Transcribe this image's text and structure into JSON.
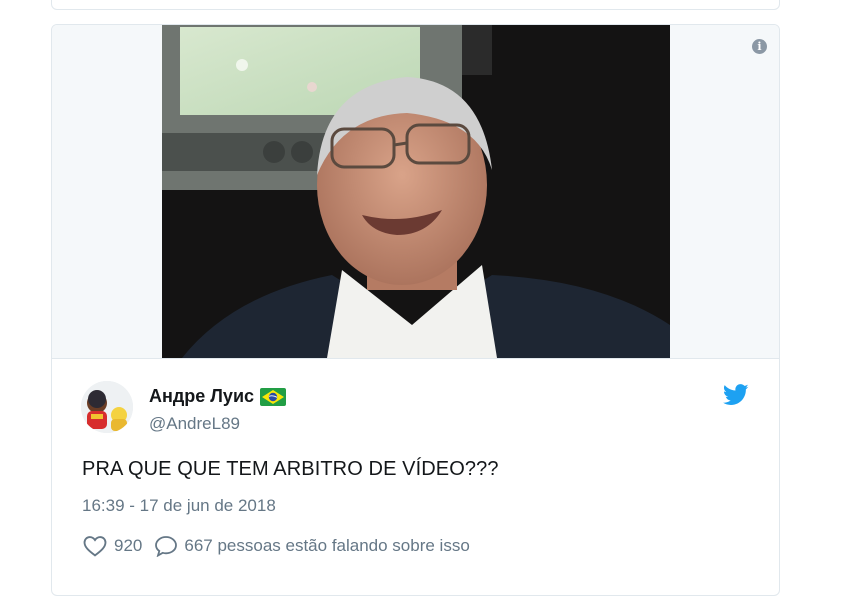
{
  "tweet": {
    "display_name": "Андре Луис",
    "handle": "@AndreL89",
    "text": "PRA QUE QUE TEM ARBITRO DE VÍDEO???",
    "timestamp": "16:39 - 17 de jun de 2018",
    "likes": "920",
    "conversation": "667 pessoas estão falando sobre isso"
  },
  "icons": {
    "info": "info-icon",
    "bird": "twitter-bird-icon",
    "flag": "brazil-flag-icon",
    "like": "heart-icon",
    "reply": "speech-bubble-icon"
  },
  "colors": {
    "accent": "#1da1f2",
    "text": "#14171a",
    "muted": "#657786",
    "border": "#e1e8ed"
  }
}
